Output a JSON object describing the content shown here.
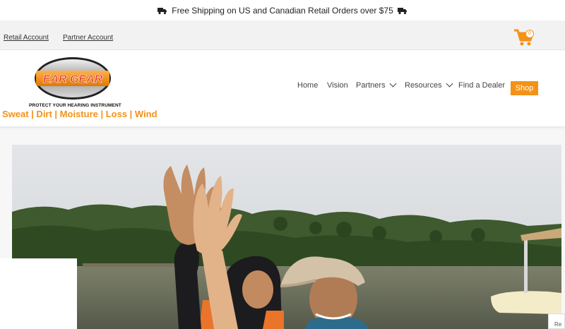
{
  "promo": {
    "text": "Free Shipping on US and Canadian Retail Orders over $75"
  },
  "accounts": {
    "retail": "Retail Account",
    "partner": "Partner Account"
  },
  "cart": {
    "count": "0"
  },
  "logo": {
    "brand": "EAR GEAR",
    "tagline": "PROTECT YOUR HEARING INSTRUMENT",
    "slogan": "Sweat | Dirt | Moisture | Loss | Wind"
  },
  "nav": {
    "home": "Home",
    "vision": "Vision",
    "partners": "Partners",
    "resources": "Resources",
    "find_dealer": "Find a Dealer",
    "shop": "Shop"
  },
  "widget": {
    "label": "Re"
  },
  "colors": {
    "accent": "#f39217",
    "logo_red": "#e0301e",
    "logo_silver": "#9a9a9a"
  }
}
